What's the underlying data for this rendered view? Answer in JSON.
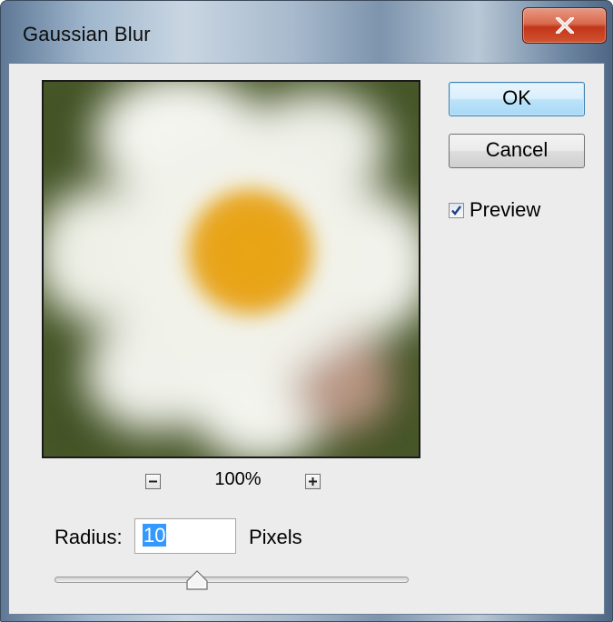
{
  "window": {
    "title": "Gaussian Blur"
  },
  "buttons": {
    "ok_label": "OK",
    "cancel_label": "Cancel"
  },
  "preview": {
    "checkbox_label": "Preview",
    "checked": true
  },
  "zoom": {
    "level": "100%",
    "zoom_out_icon": "minus-icon",
    "zoom_in_icon": "plus-icon"
  },
  "radius": {
    "label": "Radius:",
    "value": "10",
    "unit_label": "Pixels",
    "slider_position": 0.42
  },
  "colors": {
    "accent": "#3399ff",
    "close_button": "#c8452a",
    "dialog_background": "#ececec"
  }
}
